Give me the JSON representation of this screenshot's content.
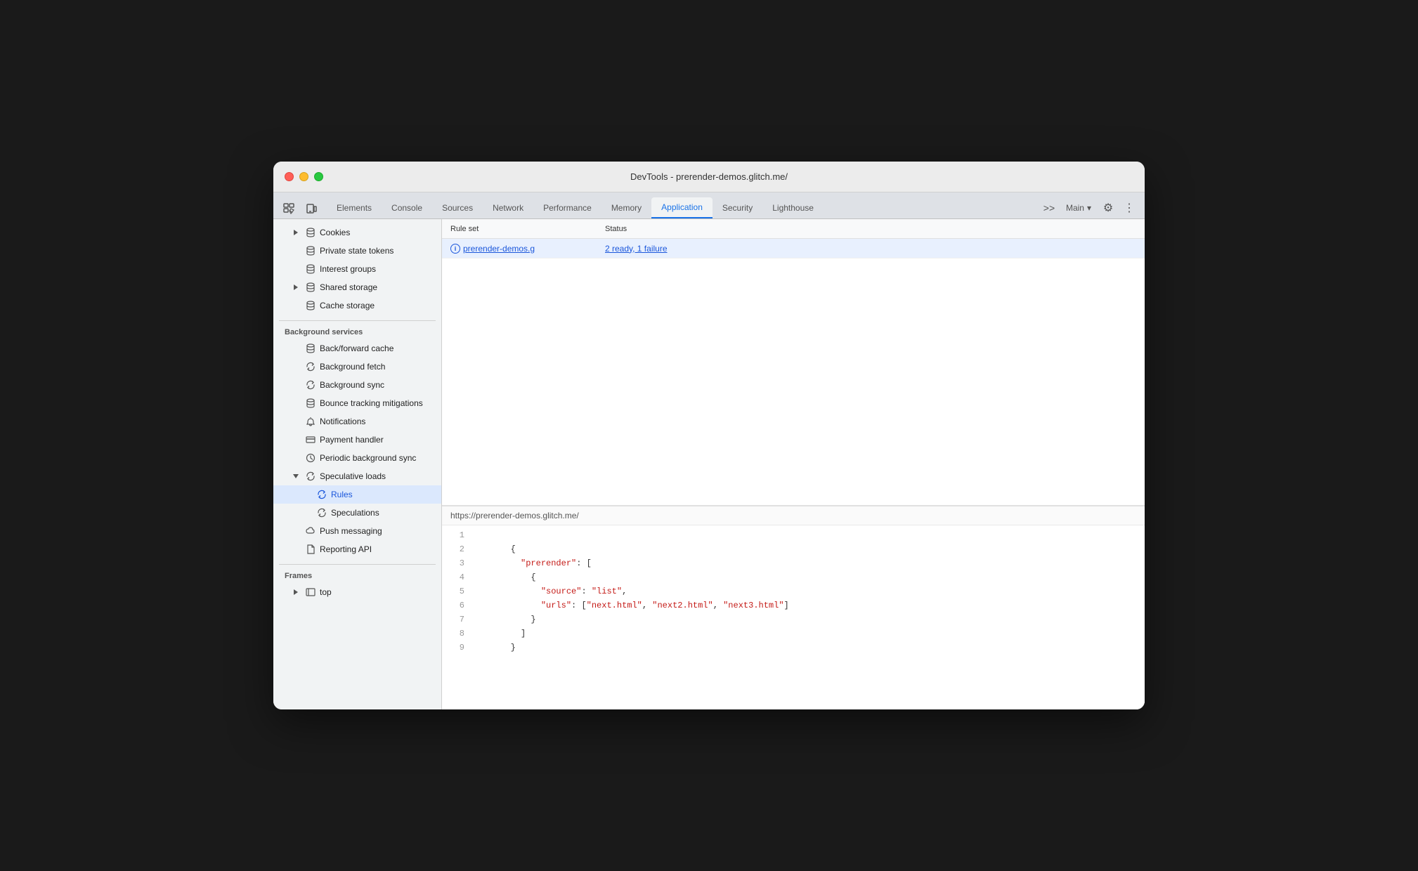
{
  "window": {
    "title": "DevTools - prerender-demos.glitch.me/"
  },
  "tabs": [
    {
      "id": "elements",
      "label": "Elements",
      "active": false
    },
    {
      "id": "console",
      "label": "Console",
      "active": false
    },
    {
      "id": "sources",
      "label": "Sources",
      "active": false
    },
    {
      "id": "network",
      "label": "Network",
      "active": false
    },
    {
      "id": "performance",
      "label": "Performance",
      "active": false
    },
    {
      "id": "memory",
      "label": "Memory",
      "active": false
    },
    {
      "id": "application",
      "label": "Application",
      "active": true
    },
    {
      "id": "security",
      "label": "Security",
      "active": false
    },
    {
      "id": "lighthouse",
      "label": "Lighthouse",
      "active": false
    }
  ],
  "right_controls": {
    "more_tabs": ">>",
    "main_label": "Main",
    "settings_label": "⚙",
    "more_label": "⋮"
  },
  "sidebar": {
    "sections": [
      {
        "id": "storage-section",
        "items": [
          {
            "id": "cookies",
            "label": "Cookies",
            "icon": "triangle-db",
            "indent": 1,
            "expandable": true
          },
          {
            "id": "private-state-tokens",
            "label": "Private state tokens",
            "icon": "db",
            "indent": 1
          },
          {
            "id": "interest-groups",
            "label": "Interest groups",
            "icon": "db",
            "indent": 1
          },
          {
            "id": "shared-storage",
            "label": "Shared storage",
            "icon": "db",
            "indent": 1,
            "expandable": true
          },
          {
            "id": "cache-storage",
            "label": "Cache storage",
            "icon": "db",
            "indent": 1
          }
        ]
      },
      {
        "id": "background-services",
        "header": "Background services",
        "items": [
          {
            "id": "back-forward-cache",
            "label": "Back/forward cache",
            "icon": "db",
            "indent": 1
          },
          {
            "id": "background-fetch",
            "label": "Background fetch",
            "icon": "sync",
            "indent": 1
          },
          {
            "id": "background-sync",
            "label": "Background sync",
            "icon": "sync",
            "indent": 1
          },
          {
            "id": "bounce-tracking",
            "label": "Bounce tracking mitigations",
            "icon": "db",
            "indent": 1
          },
          {
            "id": "notifications",
            "label": "Notifications",
            "icon": "bell",
            "indent": 1
          },
          {
            "id": "payment-handler",
            "label": "Payment handler",
            "icon": "card",
            "indent": 1
          },
          {
            "id": "periodic-background-sync",
            "label": "Periodic background sync",
            "icon": "clock",
            "indent": 1
          },
          {
            "id": "speculative-loads",
            "label": "Speculative loads",
            "icon": "sync",
            "indent": 1,
            "expanded": true
          },
          {
            "id": "rules",
            "label": "Rules",
            "icon": "sync",
            "indent": 2,
            "active": true
          },
          {
            "id": "speculations",
            "label": "Speculations",
            "icon": "sync",
            "indent": 2
          },
          {
            "id": "push-messaging",
            "label": "Push messaging",
            "icon": "cloud",
            "indent": 1
          },
          {
            "id": "reporting-api",
            "label": "Reporting API",
            "icon": "doc",
            "indent": 1
          }
        ]
      },
      {
        "id": "frames-section",
        "header": "Frames",
        "items": [
          {
            "id": "top-frame",
            "label": "top",
            "icon": "frame",
            "indent": 1,
            "expandable": true
          }
        ]
      }
    ]
  },
  "table": {
    "headers": [
      {
        "id": "ruleset",
        "label": "Rule set"
      },
      {
        "id": "status",
        "label": "Status"
      }
    ],
    "rows": [
      {
        "id": "row1",
        "ruleset": "prerender-demos.g",
        "status": "2 ready, 1 failure",
        "selected": true
      }
    ]
  },
  "bottom_panel": {
    "url": "https://prerender-demos.glitch.me/",
    "code_lines": [
      {
        "num": "1",
        "content": ""
      },
      {
        "num": "2",
        "content": "        {"
      },
      {
        "num": "3",
        "content": "          \"prerender\": ["
      },
      {
        "num": "4",
        "content": "            {"
      },
      {
        "num": "5",
        "content": "              \"source\": \"list\","
      },
      {
        "num": "6",
        "content": "              \"urls\": [\"next.html\", \"next2.html\", \"next3.html\"]"
      },
      {
        "num": "7",
        "content": "            }"
      },
      {
        "num": "8",
        "content": "          ]"
      },
      {
        "num": "9",
        "content": "        }"
      }
    ]
  }
}
